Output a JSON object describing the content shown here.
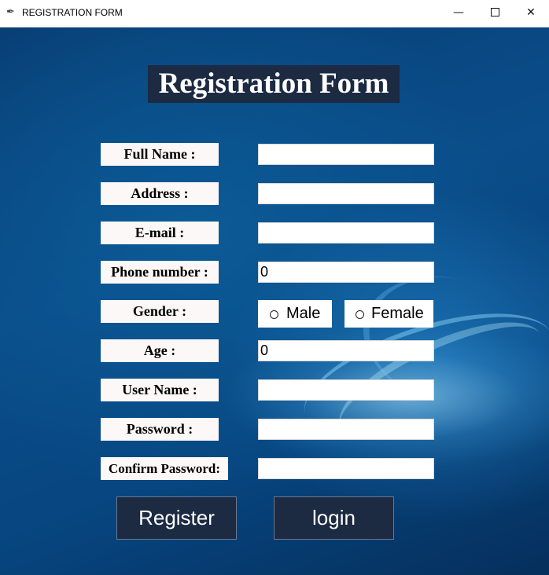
{
  "window": {
    "title": "REGISTRATION FORM",
    "minimize": "—",
    "close": "✕"
  },
  "heading": "Registration Form",
  "fields": {
    "full_name": {
      "label": "Full Name :",
      "value": ""
    },
    "address": {
      "label": "Address :",
      "value": ""
    },
    "email": {
      "label": "E-mail :",
      "value": ""
    },
    "phone": {
      "label": "Phone number :",
      "value": "0"
    },
    "gender": {
      "label": "Gender :",
      "options": [
        "Male",
        "Female"
      ]
    },
    "age": {
      "label": "Age :",
      "value": "0"
    },
    "username": {
      "label": "User Name :",
      "value": ""
    },
    "password": {
      "label": "Password :",
      "value": ""
    },
    "confirm_password": {
      "label": "Confirm Password:",
      "value": ""
    }
  },
  "buttons": {
    "register": "Register",
    "login": "login"
  },
  "colors": {
    "panel_dark": "#1c2a42",
    "label_bg": "#fcf8f8",
    "background": "#0a4d8a"
  }
}
